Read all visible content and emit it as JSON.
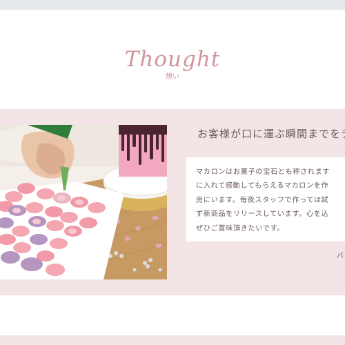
{
  "section": {
    "title": "Thought",
    "subtitle": "想い"
  },
  "feature": {
    "headline": "お客様が口に運ぶ瞬間までをテ",
    "body_lines": [
      "マカロンはお菓子の宝石とも称されます",
      "に入れて感動してもらえるマカロンを作",
      "房にいます。毎夜スタッフで作っては試",
      "ず新商品をリリースしています。心を込",
      "ぜひご賞味頂きたいです。"
    ],
    "more_link": "バ"
  },
  "colors": {
    "accent": "#d1959b",
    "band": "#f3e4e5",
    "text": "#6b5a5c",
    "topbar": "#e5e9ec"
  },
  "image": {
    "icon": "macaron-photo"
  }
}
